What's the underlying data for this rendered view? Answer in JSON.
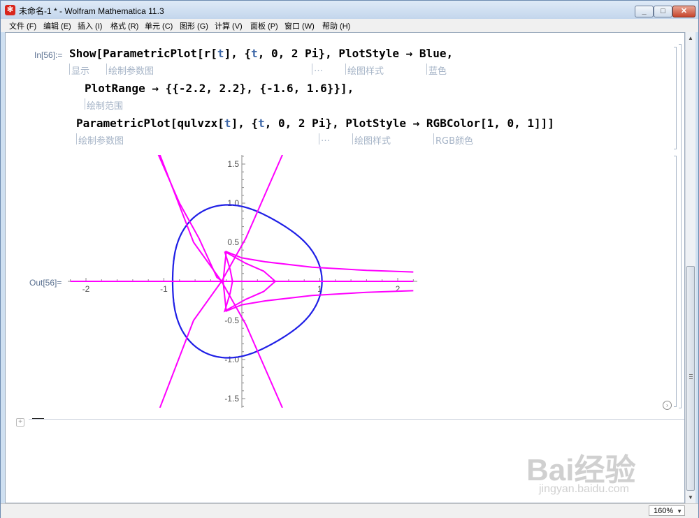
{
  "window": {
    "title": "未命名-1 * - Wolfram Mathematica 11.3",
    "app_icon": "mathematica-icon",
    "buttons": {
      "minimize": "—",
      "maximize": "▢",
      "close": "✕"
    }
  },
  "menu": [
    "文件 (F)",
    "编辑 (E)",
    "插入 (I)",
    "格式 (R)",
    "单元 (C)",
    "图形 (G)",
    "计算 (V)",
    "面板 (P)",
    "窗口 (W)",
    "帮助 (H)"
  ],
  "input_cell": {
    "label": "In[56]:=",
    "line1": {
      "show": "Show",
      "open": "[ParametricPlot[r[",
      "t1": "t",
      "mid": "], {",
      "t2": "t",
      "rest": ", 0, 2 Pi}, PlotStyle → Blue,"
    },
    "hints1": [
      "显示",
      "绘制参数图",
      "…",
      "绘图样式",
      "蓝色"
    ],
    "line2": "PlotRange → {{-2.2, 2.2}, {-1.6, 1.6}}],",
    "hints2": [
      "绘制范围"
    ],
    "line3": {
      "pre": "ParametricPlot[qulvzx[",
      "t1": "t",
      "mid": "], {",
      "t2": "t",
      "rest": ", 0, 2 Pi}, PlotStyle → RGBColor[1, 0, 1]]]"
    },
    "hints3": [
      "绘制参数图",
      "…",
      "绘图样式",
      "RGB颜色"
    ]
  },
  "output_cell": {
    "label": "Out[56]="
  },
  "chart_data": {
    "type": "line",
    "title": "",
    "xlabel": "",
    "ylabel": "",
    "xlim": [
      -2.2,
      2.2
    ],
    "ylim": [
      -1.6,
      1.6
    ],
    "x_ticks": [
      "-2",
      "-1",
      "1",
      "2"
    ],
    "y_ticks": [
      "1.5",
      "1.0",
      "0.5",
      "-0.5",
      "-1.0",
      "-1.5"
    ],
    "series": [
      {
        "color": "#1f1fe6",
        "role": "closed curve"
      },
      {
        "color": "#ff00ff",
        "role": "open curves"
      }
    ]
  },
  "statusbar": {
    "zoom": "160%"
  },
  "watermark": {
    "main": "Bai经验",
    "sub": "jingyan.baidu.com"
  }
}
